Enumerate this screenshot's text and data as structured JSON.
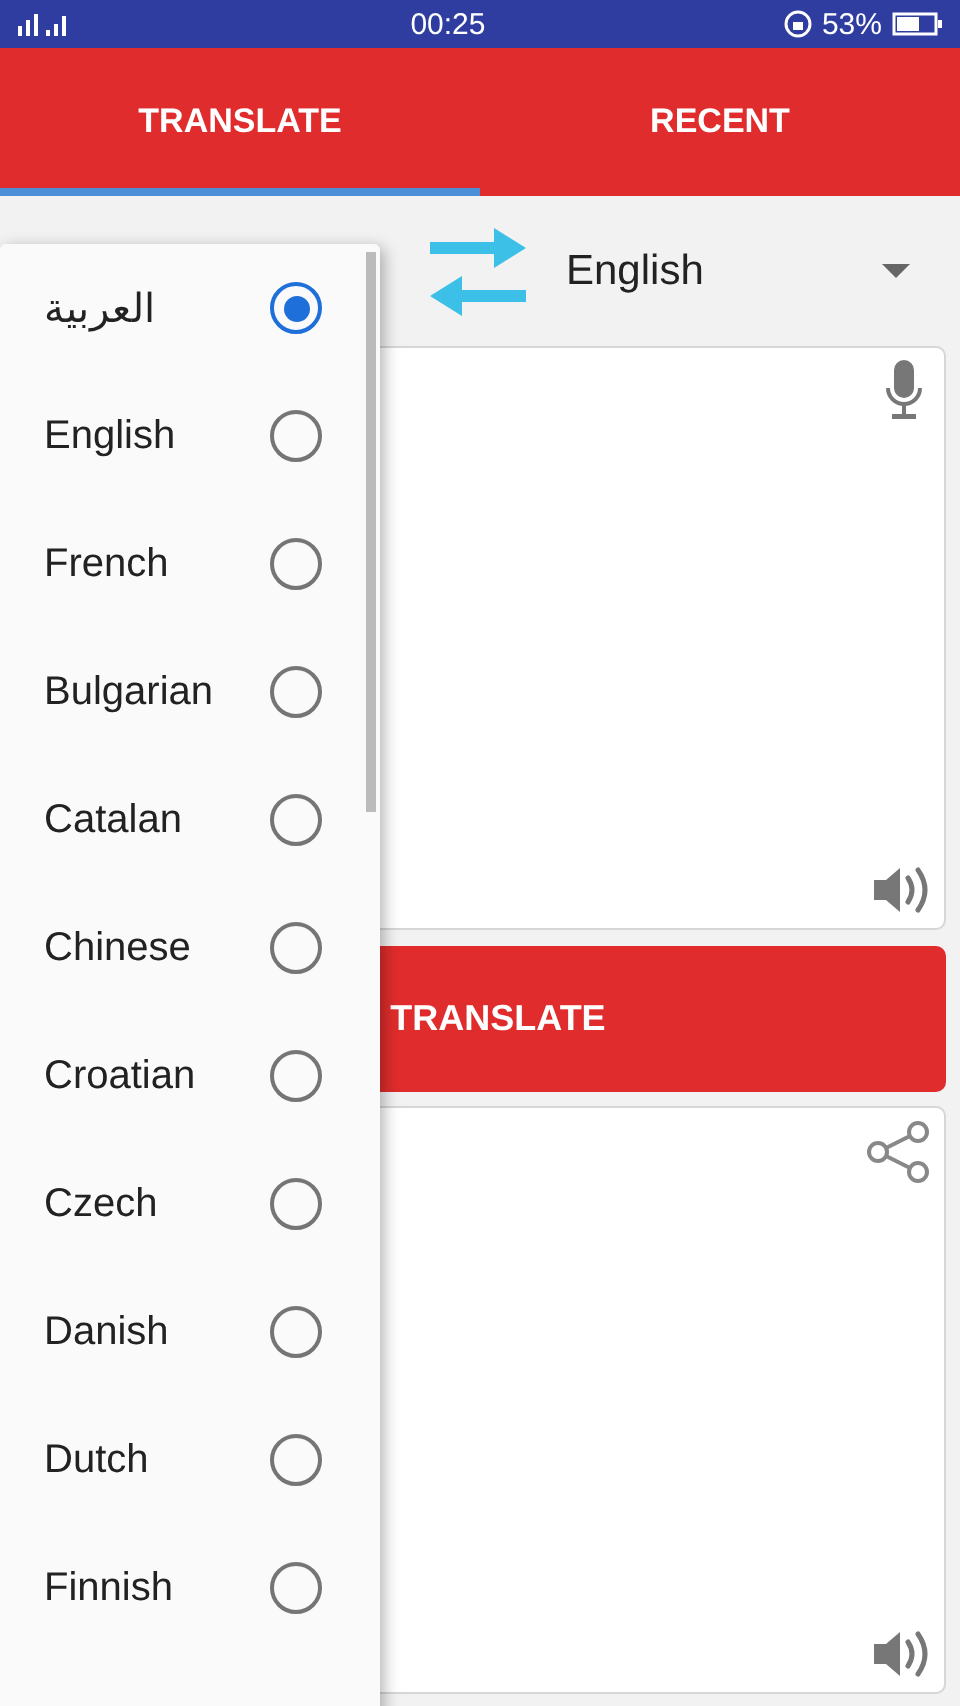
{
  "status_bar": {
    "time": "00:25",
    "battery": "53%"
  },
  "tabs": [
    {
      "label": "TRANSLATE",
      "selected": true
    },
    {
      "label": "RECENT",
      "selected": false
    }
  ],
  "target_language": "English",
  "translate_button": "TRANSLATE",
  "language_menu": [
    {
      "name": "العربية",
      "selected": true
    },
    {
      "name": "English",
      "selected": false
    },
    {
      "name": "French",
      "selected": false
    },
    {
      "name": "Bulgarian",
      "selected": false
    },
    {
      "name": "Catalan",
      "selected": false
    },
    {
      "name": "Chinese",
      "selected": false
    },
    {
      "name": "Croatian",
      "selected": false
    },
    {
      "name": "Czech",
      "selected": false
    },
    {
      "name": "Danish",
      "selected": false
    },
    {
      "name": "Dutch",
      "selected": false
    },
    {
      "name": "Finnish",
      "selected": false
    }
  ]
}
